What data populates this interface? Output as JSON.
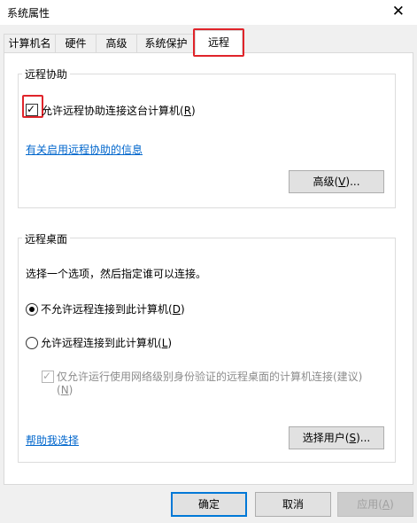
{
  "window": {
    "title": "系统属性",
    "close_glyph": "✕"
  },
  "tabs": [
    {
      "label": "计算机名"
    },
    {
      "label": "硬件"
    },
    {
      "label": "高级"
    },
    {
      "label": "系统保护"
    },
    {
      "label": "远程"
    }
  ],
  "remote_assistance": {
    "group_title": "远程协助",
    "allow_checkbox": {
      "label": "允许远程协助连接这台计算机",
      "accel": "R",
      "checked": true
    },
    "info_link": "有关启用远程协助的信息",
    "advanced_button": {
      "label": "高级",
      "accel": "V",
      "suffix": "..."
    }
  },
  "remote_desktop": {
    "group_title": "远程桌面",
    "description": "选择一个选项，然后指定谁可以连接。",
    "option_disallow": {
      "label": "不允许远程连接到此计算机",
      "accel": "D",
      "selected": true
    },
    "option_allow": {
      "label": "允许远程连接到此计算机",
      "accel": "L",
      "selected": false
    },
    "nla_checkbox": {
      "line1": "仅允许运行使用网络级别身份验证的远程桌面的计算机连接(建议)",
      "accel": "N",
      "checked": true,
      "enabled": false
    },
    "help_link": "帮助我选择",
    "select_users_button": {
      "label": "选择用户",
      "accel": "S",
      "suffix": "..."
    }
  },
  "footer": {
    "ok_label": "确定",
    "cancel_label": "取消",
    "apply_label": "应用",
    "apply_accel": "A"
  },
  "colors": {
    "highlight": "#e0242a",
    "link": "#0066cc",
    "focus_border": "#0078d7"
  }
}
